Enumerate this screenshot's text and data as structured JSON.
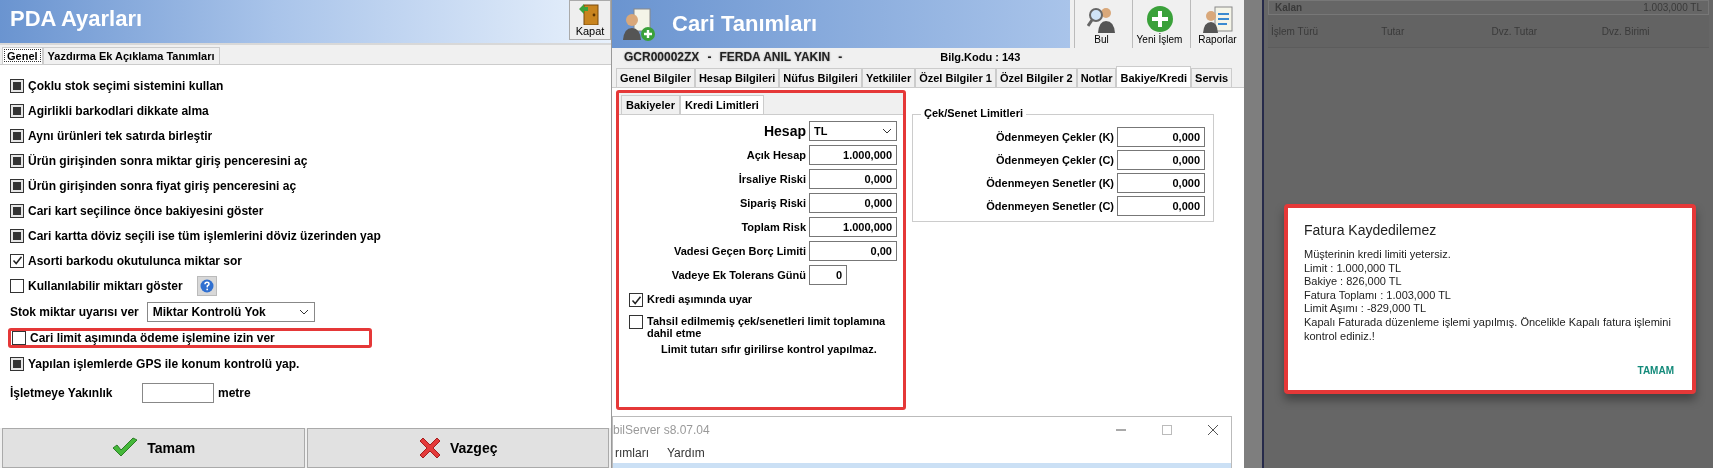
{
  "pda_settings": {
    "title": "PDA Ayarları",
    "close_button": "Kapat",
    "tabs": [
      {
        "label": "Genel",
        "selected": true
      },
      {
        "label": "Yazdırma Ek Açıklama Tanımları",
        "selected": false
      }
    ],
    "options": [
      {
        "kind": "checkbox",
        "label": "Çoklu stok seçimi sistemini kullan",
        "checked": true,
        "grayed": true,
        "highlighted": false,
        "has_help": false
      },
      {
        "kind": "checkbox",
        "label": "Agirlikli barkodlari dikkate alma",
        "checked": true,
        "grayed": true,
        "highlighted": false,
        "has_help": false
      },
      {
        "kind": "checkbox",
        "label": "Aynı ürünleri tek satırda birleştir",
        "checked": true,
        "grayed": true,
        "highlighted": false,
        "has_help": false
      },
      {
        "kind": "checkbox",
        "label": "Ürün girişinden sonra miktar giriş penceresini aç",
        "checked": true,
        "grayed": true,
        "highlighted": false,
        "has_help": false
      },
      {
        "kind": "checkbox",
        "label": "Ürün girişinden sonra fiyat giriş penceresini aç",
        "checked": true,
        "grayed": true,
        "highlighted": false,
        "has_help": false
      },
      {
        "kind": "checkbox",
        "label": "Cari kart seçilince önce bakiyesini göster",
        "checked": true,
        "grayed": true,
        "highlighted": false,
        "has_help": false
      },
      {
        "kind": "checkbox",
        "label": "Cari kartta döviz seçili ise tüm işlemlerini döviz üzerinden yap",
        "checked": true,
        "grayed": true,
        "highlighted": false,
        "has_help": false
      },
      {
        "kind": "checkbox",
        "label": "Asorti barkodu okutulunca miktar sor",
        "checked": true,
        "grayed": false,
        "highlighted": false,
        "has_help": false
      },
      {
        "kind": "checkbox",
        "label": "Kullanılabilir miktarı göster",
        "checked": false,
        "grayed": false,
        "highlighted": false,
        "has_help": true
      },
      {
        "kind": "select",
        "label": "Stok miktar uyarısı ver",
        "value": "Miktar Kontrolü Yok"
      },
      {
        "kind": "checkbox",
        "label": "Cari limit aşımında ödeme işlemine izin ver",
        "checked": false,
        "grayed": false,
        "highlighted": true,
        "has_help": false
      },
      {
        "kind": "checkbox",
        "label": "Yapılan işlemlerde GPS ile konum kontrolü yap.",
        "checked": true,
        "grayed": true,
        "highlighted": false,
        "has_help": false
      },
      {
        "kind": "input",
        "label": "İşletmeye Yakınlık",
        "unit": "metre"
      }
    ],
    "buttons": [
      {
        "kind": "ok",
        "label": "Tamam"
      },
      {
        "kind": "cancel",
        "label": "Vazgeç"
      }
    ]
  },
  "cari": {
    "title": "Cari Tanımları",
    "toolbar": [
      {
        "kind": "find",
        "label": "Bul"
      },
      {
        "kind": "new",
        "label": "Yeni İşlem"
      },
      {
        "kind": "report",
        "label": "Raporlar"
      }
    ],
    "header_parts": [
      "GCR00002ZX",
      "-",
      "FERDA ANIL YAKIN",
      "-"
    ],
    "info": "Bilg.Kodu : 143",
    "tabs": [
      {
        "label": "Genel Bilgiler",
        "selected": false
      },
      {
        "label": "Hesap Bilgileri",
        "selected": false
      },
      {
        "label": "Nüfus Bilgileri",
        "selected": false
      },
      {
        "label": "Yetkililer",
        "selected": false
      },
      {
        "label": "Özel Bilgiler 1",
        "selected": false
      },
      {
        "label": "Özel Bilgiler 2",
        "selected": false
      },
      {
        "label": "Notlar",
        "selected": false
      },
      {
        "label": "Bakiye/Kredi",
        "selected": true
      },
      {
        "label": "Servis",
        "selected": false
      }
    ],
    "credit_panel": {
      "highlighted": true,
      "tabs": [
        {
          "label": "Bakiyeler",
          "selected": false
        },
        {
          "label": "Kredi Limitleri",
          "selected": true
        }
      ],
      "fields": [
        {
          "kind": "select",
          "label": "Hesap",
          "value": "TL"
        },
        {
          "kind": "number",
          "label": "Açık Hesap",
          "value": "1.000,000"
        },
        {
          "kind": "number",
          "label": "İrsaliye Riski",
          "value": "0,000"
        },
        {
          "kind": "number",
          "label": "Sipariş Riski",
          "value": "0,000"
        },
        {
          "kind": "number",
          "label": "Toplam Risk",
          "value": "1.000,000"
        },
        {
          "kind": "number",
          "label": "Vadesi Geçen Borç Limiti",
          "value": "0,00"
        },
        {
          "kind": "small",
          "label": "Vadeye Ek Tolerans Günü",
          "value": "0"
        }
      ],
      "checks": [
        {
          "label": "Kredi aşımında uyar",
          "checked": true
        },
        {
          "label": "Tahsil edilmemiş çek/senetleri limit toplamına dahil etme",
          "checked": false
        }
      ],
      "note": "Limit tutarı sıfır girilirse kontrol yapılmaz."
    },
    "limits_group": {
      "title": "Çek/Senet Limitleri",
      "fields": [
        {
          "label": "Ödenmeyen Çekler (K)",
          "value": "0,000"
        },
        {
          "label": "Ödenmeyen Çekler (C)",
          "value": "0,000"
        },
        {
          "label": "Ödenmeyen Senetler (K)",
          "value": "0,000"
        },
        {
          "label": "Ödenmeyen Senetler (C)",
          "value": "0,000"
        }
      ]
    },
    "overlay_window": {
      "title": "bilServer s8.07.04",
      "menu": [
        "rımları",
        "Yardım"
      ]
    }
  },
  "mobile": {
    "summary_label": "Kalan",
    "summary_value": "1.003,000 TL",
    "columns": [
      "İşlem Türü",
      "Tutar",
      "Dvz. Tutar",
      "Dvz. Birimi"
    ],
    "dialog": {
      "title": "Fatura Kaydedilemez",
      "highlighted": true,
      "lines": [
        "Müşterinin kredi limiti yetersiz.",
        "Limit : 1.000,000 TL",
        "Bakiye : 826,000 TL",
        "Fatura Toplamı : 1.003,000 TL",
        "Limit Aşımı : -829,000 TL",
        "Kapalı Faturada düzenleme işlemi yapılmış. Öncelikle Kapalı fatura işlemini kontrol ediniz.!"
      ],
      "button": "TAMAM"
    }
  }
}
